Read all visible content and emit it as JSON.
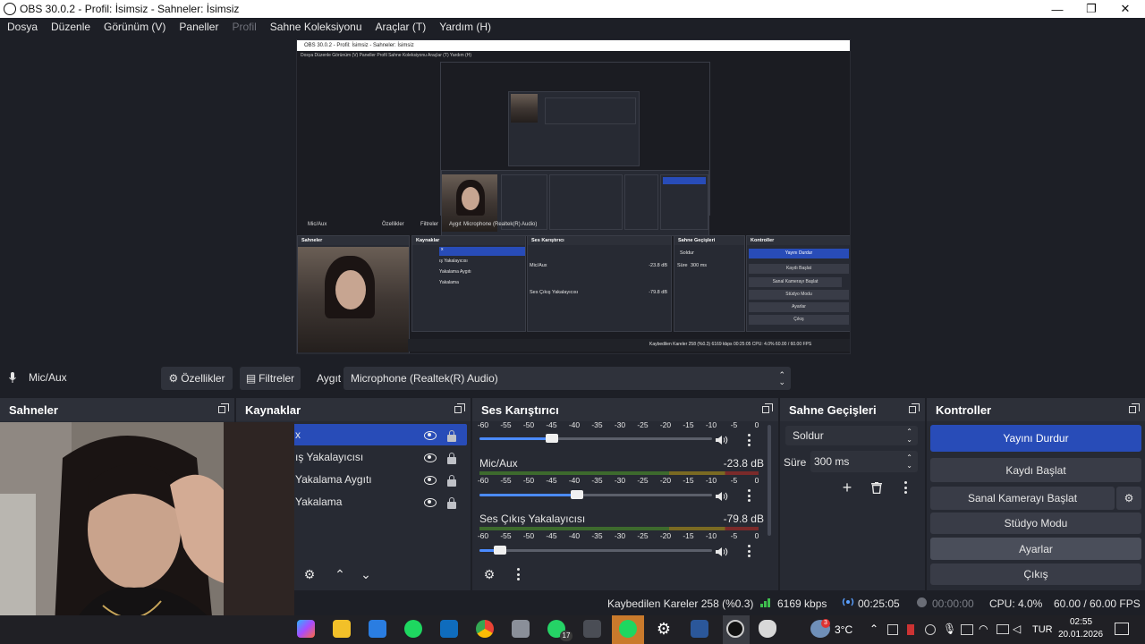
{
  "window": {
    "title": "OBS 30.0.2 - Profil: İsimsiz - Sahneler: İsimsiz",
    "controls": [
      "—",
      "❐",
      "✕"
    ]
  },
  "menu": [
    "Dosya",
    "Düzenle",
    "Görünüm (V)",
    "Paneller",
    "Profil",
    "Sahne Koleksiyonu",
    "Araçlar (T)",
    "Yardım (H)"
  ],
  "preview": {
    "title": "OBS 30.0.2 - Profil: İsimsiz - Sahneler: İsimsiz",
    "menu": "Dosya   Düzenle   Görünüm (V)   Paneller   Profil   Sahne Koleksiyonu   Araçlar (T)   Yardım (H)",
    "source_bar": "Mic/Aux",
    "props": "Özellikler",
    "filters": "Filtreler",
    "device": "Aygıt",
    "device_value": "Microphone (Realtek(R) Audio)",
    "scenes": "Sahneler",
    "sources": "Kaynaklar",
    "mixer": "Ses Karıştırıcı",
    "transitions": "Sahne Geçişleri",
    "controls": "Kontroller",
    "src_items": [
      "x",
      "ış Yakalayıcısı",
      "Yakalama Aygıtı",
      "Yakalama"
    ],
    "ch1": "Mic/Aux",
    "ch1_db": "-23.8 dB",
    "ch2": "Ses Çıkış Yakalayıcısı",
    "ch2_db": "-79.8 dB",
    "fade": "Soldur",
    "dur_label": "Süre",
    "dur": "300 ms",
    "btns": [
      "Yayını Durdur",
      "Kaydı Başlat",
      "Sanal Kamerayı Başlat",
      "Stüdyo Modu",
      "Ayarlar",
      "Çıkış"
    ],
    "status": "Kaybedilen Kareler 258 (%0.3)   6169 kbps   00:25:05   CPU: 4.0%   60.00 / 60.00 FPS"
  },
  "source_toolbar": {
    "source_name": "Mic/Aux",
    "properties": "Özellikler",
    "filters": "Filtreler",
    "device_label": "Aygıt",
    "device_value": "Microphone (Realtek(R) Audio)"
  },
  "docks": {
    "scenes": {
      "title": "Sahneler"
    },
    "sources": {
      "title": "Kaynaklar",
      "items": [
        "x",
        "ış Yakalayıcısı",
        "Yakalama Aygıtı",
        "Yakalama"
      ]
    },
    "mixer": {
      "title": "Ses Karıştırıcı",
      "scale": [
        "-60",
        "-55",
        "-50",
        "-45",
        "-40",
        "-35",
        "-30",
        "-25",
        "-20",
        "-15",
        "-10",
        "-5",
        "0"
      ],
      "channels": [
        {
          "name": "",
          "db": "",
          "volume": 0.31
        },
        {
          "name": "Mic/Aux",
          "db": "-23.8 dB",
          "volume": 0.42
        },
        {
          "name": "Ses Çıkış Yakalayıcısı",
          "db": "-79.8 dB",
          "volume": 0.09
        }
      ]
    },
    "transitions": {
      "title": "Sahne Geçişleri",
      "transition": "Soldur",
      "duration_label": "Süre",
      "duration_value": "300 ms"
    },
    "controls": {
      "title": "Kontroller",
      "stop_stream": "Yayını Durdur",
      "start_recording": "Kaydı Başlat",
      "start_virtualcam": "Sanal Kamerayı Başlat",
      "studio_mode": "Stüdyo Modu",
      "settings": "Ayarlar",
      "exit": "Çıkış"
    }
  },
  "status": {
    "dropped_frames": "Kaybedilen Kareler 258 (%0.3)",
    "bitrate": "6169 kbps",
    "stream_time": "00:25:05",
    "rec_time": "00:00:00",
    "cpu": "CPU: 4.0%",
    "fps": "60.00 / 60.00 FPS"
  },
  "taskbar": {
    "whatsapp_badge": "17",
    "weather_badge": "3",
    "temperature": "3°C",
    "language": "TUR",
    "time": "02:55",
    "date": "20.01.2026"
  },
  "colors": {
    "accent": "#284cb8",
    "panel": "#272a33",
    "background": "#1d1f26"
  }
}
